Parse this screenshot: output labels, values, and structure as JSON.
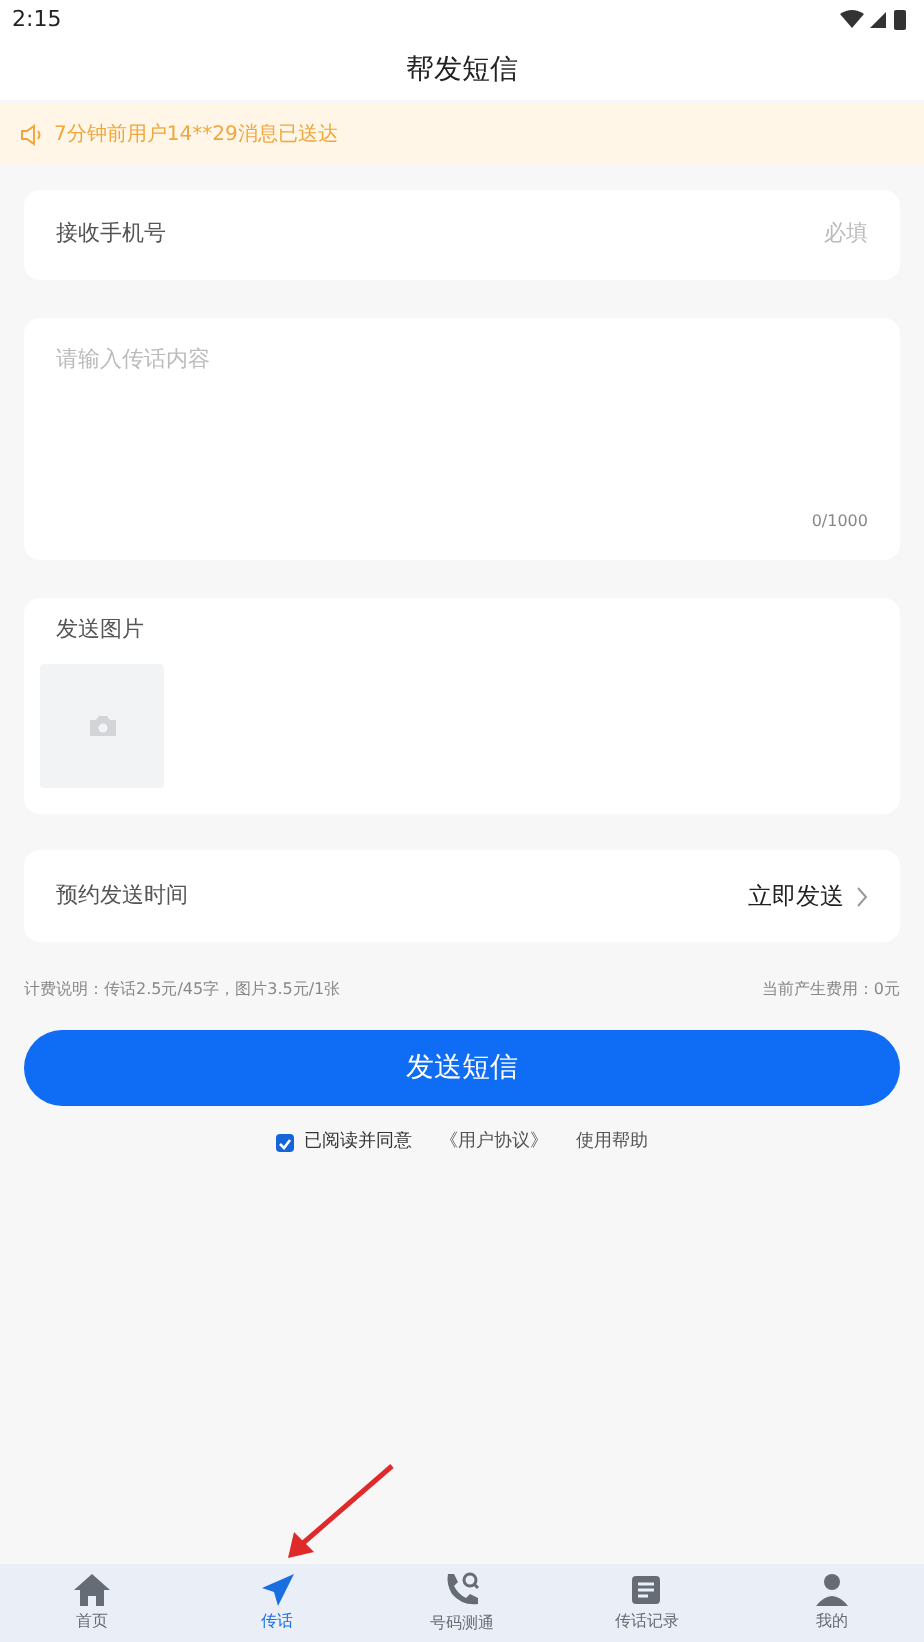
{
  "status_bar": {
    "time": "2:15"
  },
  "title": "帮发短信",
  "notice": "7分钟前用户14**29消息已送达",
  "phone_field": {
    "label": "接收手机号",
    "placeholder": "必填"
  },
  "message_field": {
    "placeholder": "请输入传话内容",
    "counter": "0/1000"
  },
  "image_section": {
    "label": "发送图片"
  },
  "schedule": {
    "label": "预约发送时间",
    "value": "立即发送"
  },
  "pricing": {
    "note": "计费说明：传话2.5元/45字，图片3.5元/1张",
    "cost": "当前产生费用：0元"
  },
  "send_button": "发送短信",
  "agreement": {
    "checked": true,
    "text": "已阅读并同意",
    "link": "《用户协议》",
    "help": "使用帮助"
  },
  "tabs": [
    {
      "kind": "home",
      "label": "首页",
      "selected": false
    },
    {
      "kind": "send",
      "label": "传话",
      "selected": true
    },
    {
      "kind": "phone",
      "label": "号码测通",
      "selected": false
    },
    {
      "kind": "records",
      "label": "传话记录",
      "selected": false
    },
    {
      "kind": "me",
      "label": "我的",
      "selected": false
    }
  ]
}
